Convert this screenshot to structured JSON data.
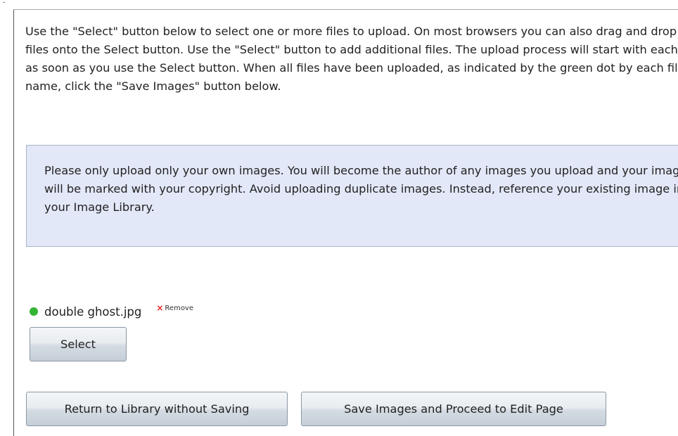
{
  "page": {
    "corner_mark": "."
  },
  "instructions": {
    "text": "Use the \"Select\" button below to select one or more files to upload. On most browsers you can also drag and drop files onto the Select button. Use the \"Select\" button to add additional files. The upload process will start with each file as soon as you use the Select button. When all files have been uploaded, as indicated by the green dot by each file name, click the \"Save Images\" button below."
  },
  "notice": {
    "text": "Please only upload only your own images. You will become the author of any images you upload and your images will be marked with your copyright. Avoid uploading duplicate images. Instead, reference your existing image in your Image Library."
  },
  "file_list": [
    {
      "name": "double ghost.jpg",
      "status_color": "#33b433",
      "remove_label": "Remove",
      "remove_icon": "close-icon"
    }
  ],
  "buttons": {
    "select_label": "Select",
    "return_label": "Return to Library without Saving",
    "save_label": "Save Images and Proceed to Edit Page"
  },
  "colors": {
    "notice_background": "#e3e8f8",
    "notice_border": "#a9b2c8",
    "success_dot": "#33b433",
    "remove_x": "#e02020"
  }
}
